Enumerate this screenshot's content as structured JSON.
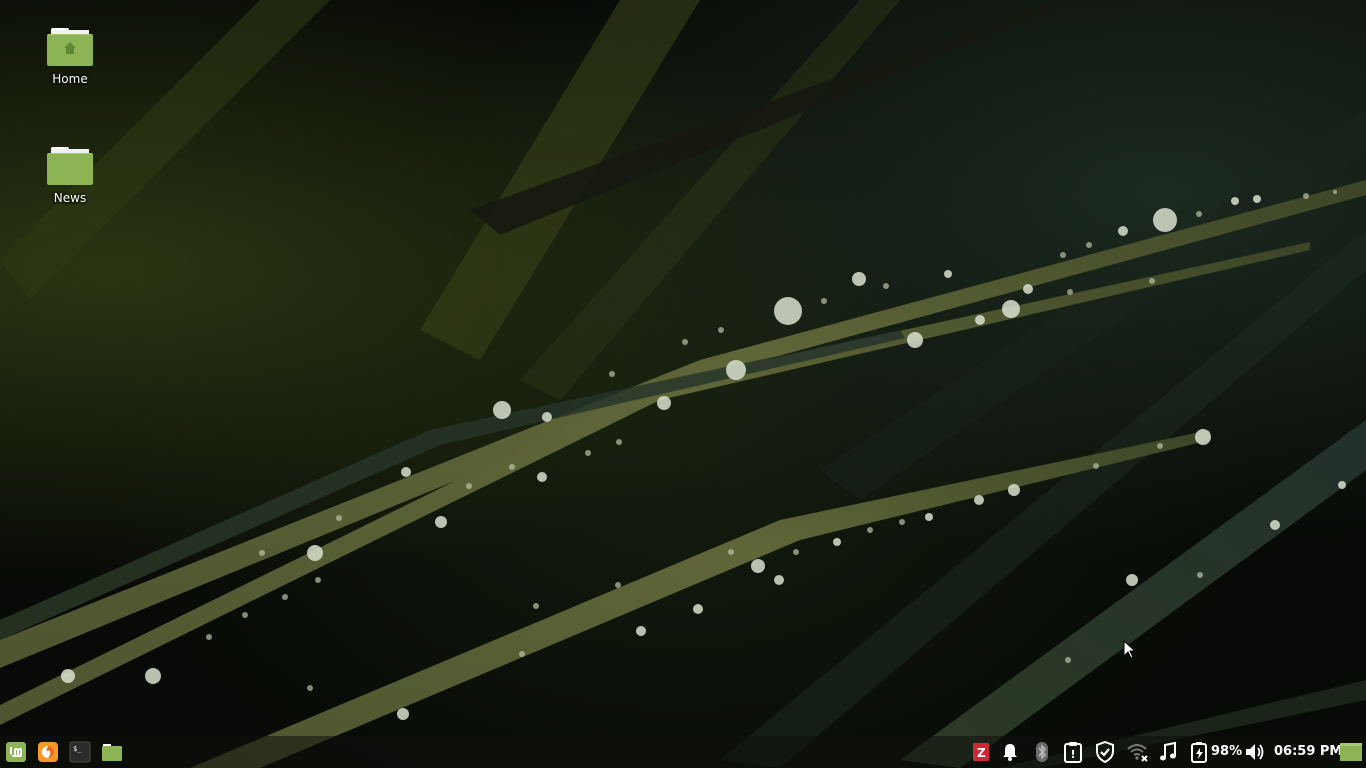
{
  "desktop": {
    "icons": [
      {
        "label": "Home",
        "type": "home-folder"
      },
      {
        "label": "News",
        "type": "folder"
      }
    ]
  },
  "panel": {
    "launchers": [
      {
        "name": "menu",
        "icon": "mint-menu-icon"
      },
      {
        "name": "firefox",
        "icon": "firefox-icon"
      },
      {
        "name": "terminal",
        "icon": "terminal-icon",
        "glyph": "$_"
      },
      {
        "name": "files",
        "icon": "folder-icon"
      }
    ],
    "tray": {
      "battery_percent": "98%",
      "clock": "06:59 PM",
      "icons": [
        "zotero-icon",
        "bell-icon",
        "bluetooth-icon",
        "clipboard-icon",
        "shield-icon",
        "wifi-disconnected-icon",
        "music-icon",
        "battery-charging-icon",
        "volume-icon",
        "show-desktop-icon"
      ],
      "zotero_glyph": "Z",
      "update_glyph": "!"
    }
  },
  "colors": {
    "folder_green": "#8cb455",
    "mint_green": "#8cb455",
    "firefox_orange": "#f59a2a",
    "zotero_red": "#cc2936"
  }
}
